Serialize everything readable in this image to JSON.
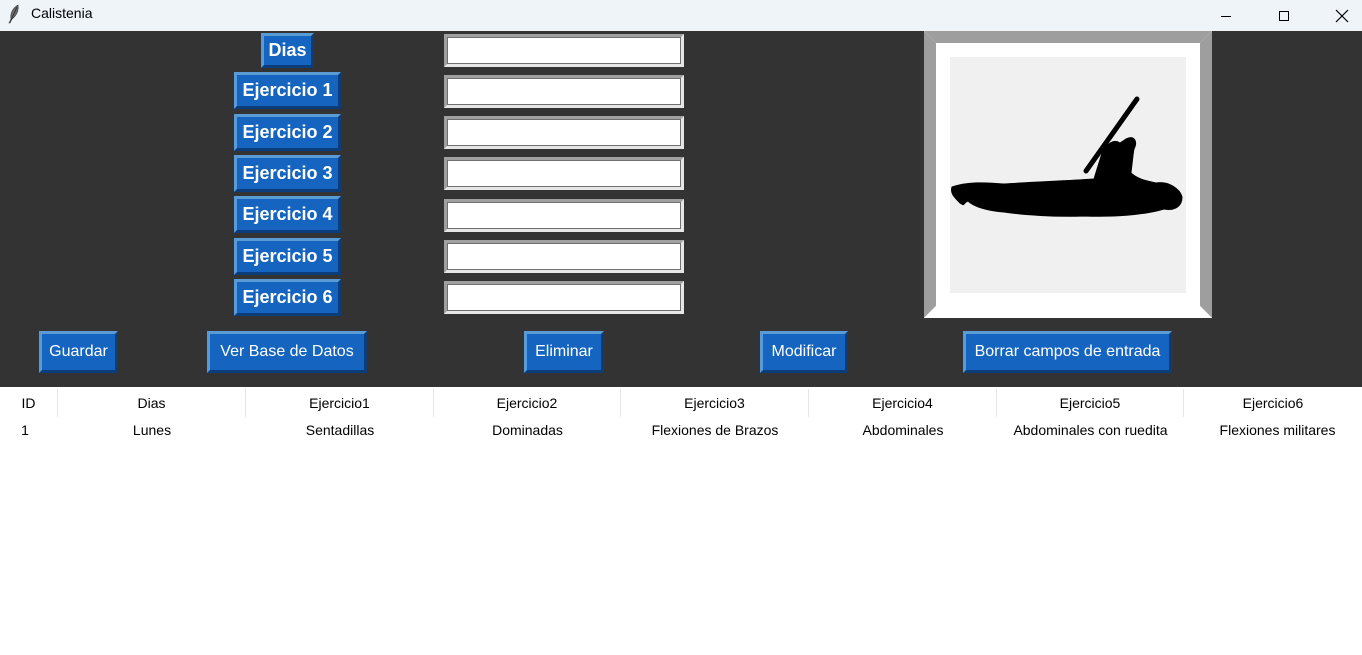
{
  "window": {
    "title": "Calistenia"
  },
  "labels": {
    "dias": "Dias",
    "ejercicio1": "Ejercicio 1",
    "ejercicio2": "Ejercicio 2",
    "ejercicio3": "Ejercicio 3",
    "ejercicio4": "Ejercicio 4",
    "ejercicio5": "Ejercicio 5",
    "ejercicio6": "Ejercicio 6"
  },
  "inputs": {
    "dias": "",
    "ejercicio1": "",
    "ejercicio2": "",
    "ejercicio3": "",
    "ejercicio4": "",
    "ejercicio5": "",
    "ejercicio6": ""
  },
  "buttons": {
    "guardar": "Guardar",
    "ver_base": "Ver Base de Datos",
    "eliminar": "Eliminar",
    "modificar": "Modificar",
    "borrar": "Borrar campos de entrada"
  },
  "image": {
    "icon": "pull-up-silhouette-icon"
  },
  "table": {
    "columns": [
      "ID",
      "Dias",
      "Ejercicio1",
      "Ejercicio2",
      "Ejercicio3",
      "Ejercicio4",
      "Ejercicio5",
      "Ejercicio6"
    ],
    "rows": [
      [
        "1",
        "Lunes",
        "Sentadillas",
        "Dominadas",
        "Flexiones de Brazos",
        "Abdominales",
        "Abdominales con ruedita",
        "Flexiones militares"
      ]
    ]
  },
  "colors": {
    "app_bg": "#333333",
    "button_blue": "#1565c0",
    "titlebar_bg": "#eff4f9"
  }
}
